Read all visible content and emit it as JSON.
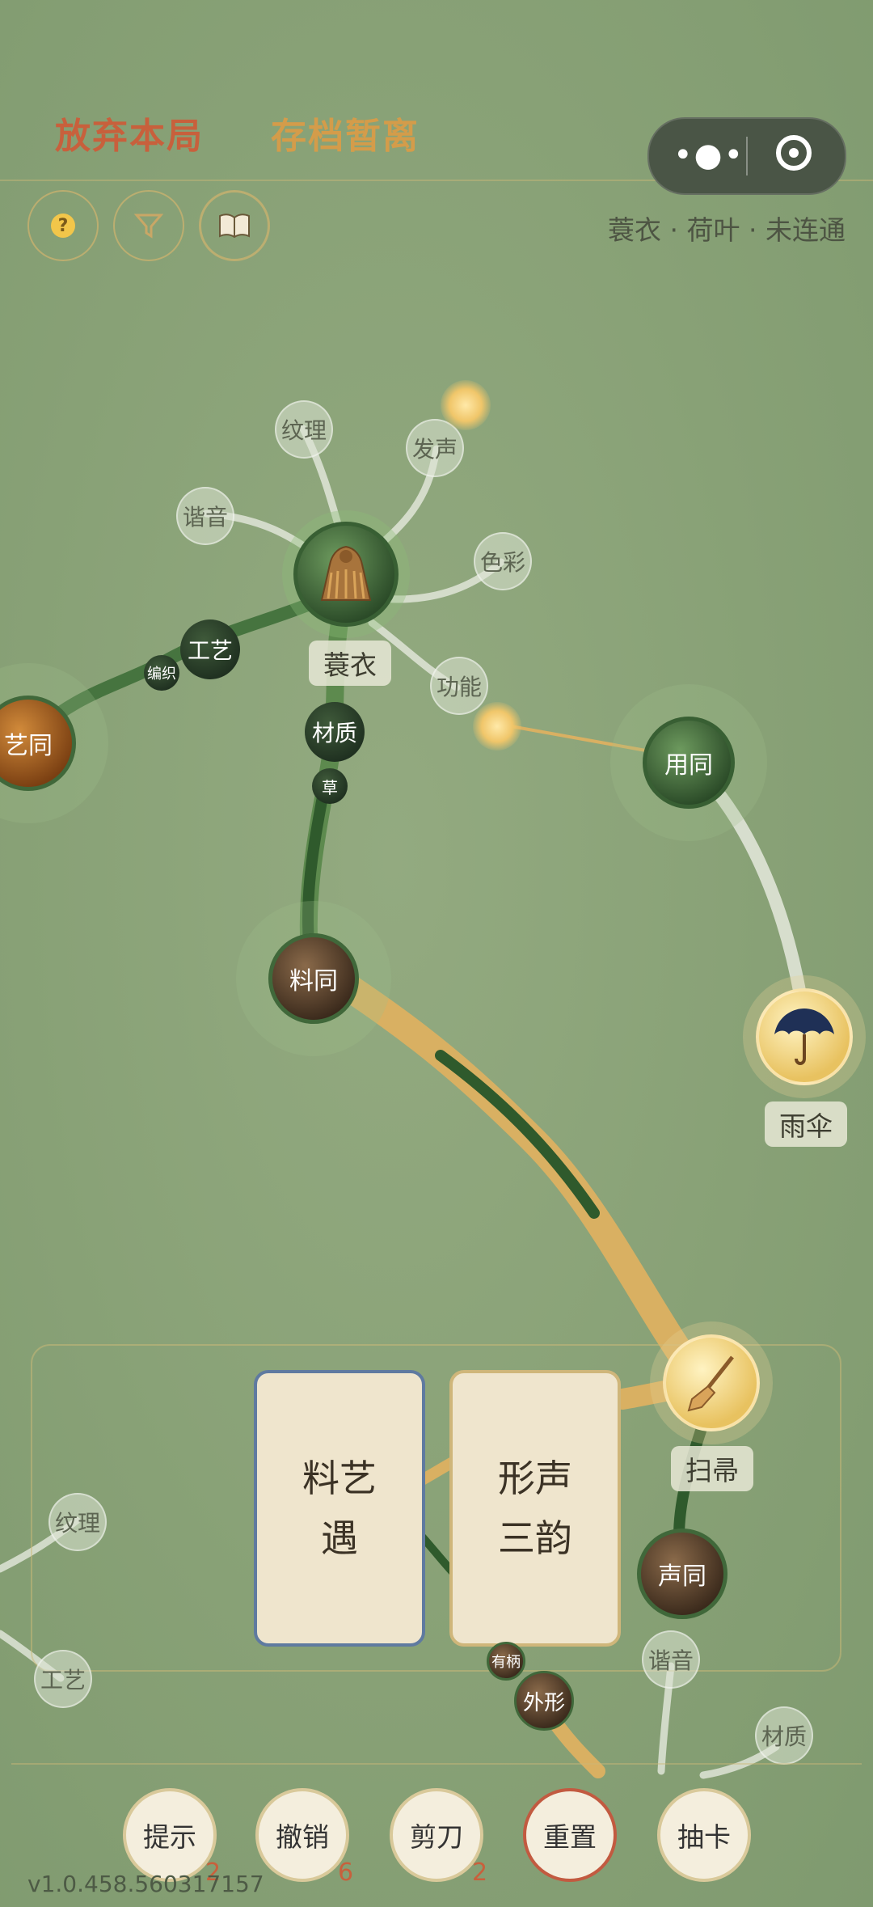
{
  "header": {
    "abandon_label": "放弃本局",
    "save_label": "存档暂离",
    "status_text": "蓑衣 · 荷叶 · 未连通",
    "help_label": "?"
  },
  "icons": {
    "help": "help-icon",
    "filter": "funnel-icon",
    "collection": "book-icon",
    "more": "more-dots-icon",
    "close": "target-icon"
  },
  "graph": {
    "center": {
      "label": "蓑衣",
      "icon": "straw-cape"
    },
    "attributes": [
      "纹理",
      "发声",
      "谐音",
      "色彩",
      "功能",
      "工艺",
      "编织",
      "材质",
      "草"
    ],
    "links": [
      "艺同",
      "用同",
      "料同",
      "声同"
    ],
    "items": [
      {
        "label": "雨伞",
        "icon": "umbrella"
      },
      {
        "label": "扫帚",
        "icon": "broom"
      }
    ],
    "lower_attributes": [
      "纹理",
      "工艺",
      "谐音",
      "材质",
      "有柄",
      "外形"
    ]
  },
  "cards": [
    {
      "line1": "料艺",
      "line2": "遇"
    },
    {
      "line1": "形声",
      "line2": "三韵"
    }
  ],
  "toolbar": {
    "hint": {
      "label": "提示",
      "count": "2"
    },
    "undo": {
      "label": "撤销",
      "count": "6"
    },
    "scissors": {
      "label": "剪刀",
      "count": "2"
    },
    "reset": {
      "label": "重置"
    },
    "draw": {
      "label": "抽卡"
    }
  },
  "version": "v1.0.458.560317157",
  "colors": {
    "background": "#88a176",
    "accent_red": "#c8603c",
    "accent_gold": "#d49c4a",
    "vine_green": "#3f6a3a",
    "vine_gold": "#d9b062"
  }
}
